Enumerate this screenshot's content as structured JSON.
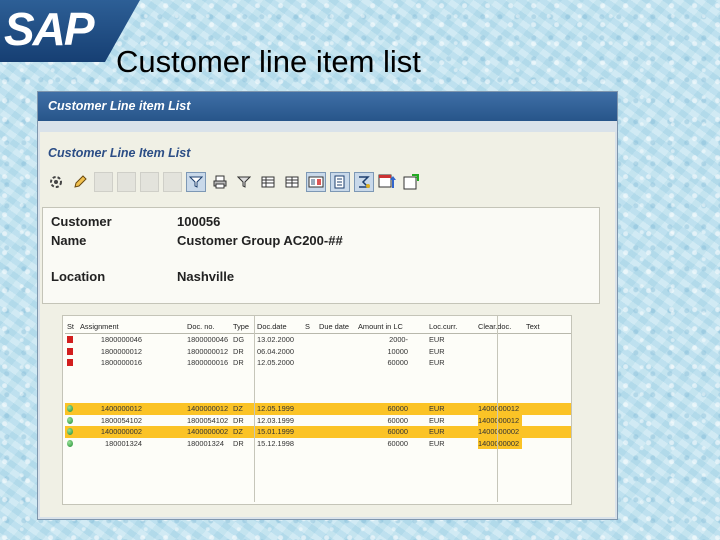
{
  "slide": {
    "logo_text": "SAP",
    "title": "Customer line item list"
  },
  "window": {
    "title": "Customer Line item List",
    "screen_title": "Customer Line Item List"
  },
  "toolbar": {
    "icons": [
      "execute-icon",
      "pencil-icon",
      "blank-slot",
      "blank-slot",
      "blank-slot",
      "blank-slot",
      "filter-icon",
      "print-icon",
      "set-filter-icon",
      "grid-icon",
      "grid-icon",
      "layout-icon",
      "details-icon",
      "sum-icon",
      "export-icon",
      "upload-icon"
    ]
  },
  "header": {
    "customer_label": "Customer",
    "customer_value": "100056",
    "name_label": "Name",
    "name_value": "Customer Group AC200-##",
    "location_label": "Location",
    "location_value": "Nashville"
  },
  "table": {
    "columns": [
      "St",
      "Assignment",
      "Doc. no.",
      "Type",
      "Doc.date",
      "S",
      "Due date",
      "Amount in LC",
      "Loc.curr.",
      "Clear.doc.",
      "Text"
    ],
    "open_items": [
      {
        "status": "red",
        "assignment": "1800000046",
        "doc_no": "1800000046",
        "type": "DG",
        "doc_date": "13.02.2000",
        "s": "",
        "due_date": "",
        "amount": "2000-",
        "curr": "EUR",
        "clear_doc": "",
        "text": ""
      },
      {
        "status": "red",
        "assignment": "1800000012",
        "doc_no": "1800000012",
        "type": "DR",
        "doc_date": "06.04.2000",
        "s": "",
        "due_date": "",
        "amount": "10000",
        "curr": "EUR",
        "clear_doc": "",
        "text": ""
      },
      {
        "status": "red",
        "assignment": "1800000016",
        "doc_no": "1800000016",
        "type": "DR",
        "doc_date": "12.05.2000",
        "s": "",
        "due_date": "",
        "amount": "60000",
        "curr": "EUR",
        "clear_doc": "",
        "text": ""
      }
    ],
    "cleared_items": [
      {
        "status": "green",
        "assignment": "1400000012",
        "doc_no": "1400000012",
        "type": "DZ",
        "doc_date": "12.05.1999",
        "s": "",
        "due_date": "",
        "amount": "60000",
        "curr": "EUR",
        "clear_doc": "1400000012",
        "text": "",
        "highlight": true
      },
      {
        "status": "green",
        "assignment": "1800054102",
        "doc_no": "1800054102",
        "type": "DR",
        "doc_date": "12.03.1999",
        "s": "",
        "due_date": "",
        "amount": "60000",
        "curr": "EUR",
        "clear_doc": "1400000012",
        "text": "",
        "highlight": false
      },
      {
        "status": "green",
        "assignment": "1400000002",
        "doc_no": "1400000002",
        "type": "DZ",
        "doc_date": "15.01.1999",
        "s": "",
        "due_date": "",
        "amount": "60000",
        "curr": "EUR",
        "clear_doc": "1400000002",
        "text": "",
        "highlight": true
      },
      {
        "status": "green",
        "assignment": "180001324",
        "doc_no": "180001324",
        "type": "DR",
        "doc_date": "15.12.1998",
        "s": "",
        "due_date": "",
        "amount": "60000",
        "curr": "EUR",
        "clear_doc": "1400000002",
        "text": "",
        "highlight": false
      }
    ]
  },
  "colors": {
    "titlebar": "#27558a",
    "highlight": "#fbc326",
    "status_open": "#d21e1e",
    "status_cleared": "#1f8b2f"
  }
}
